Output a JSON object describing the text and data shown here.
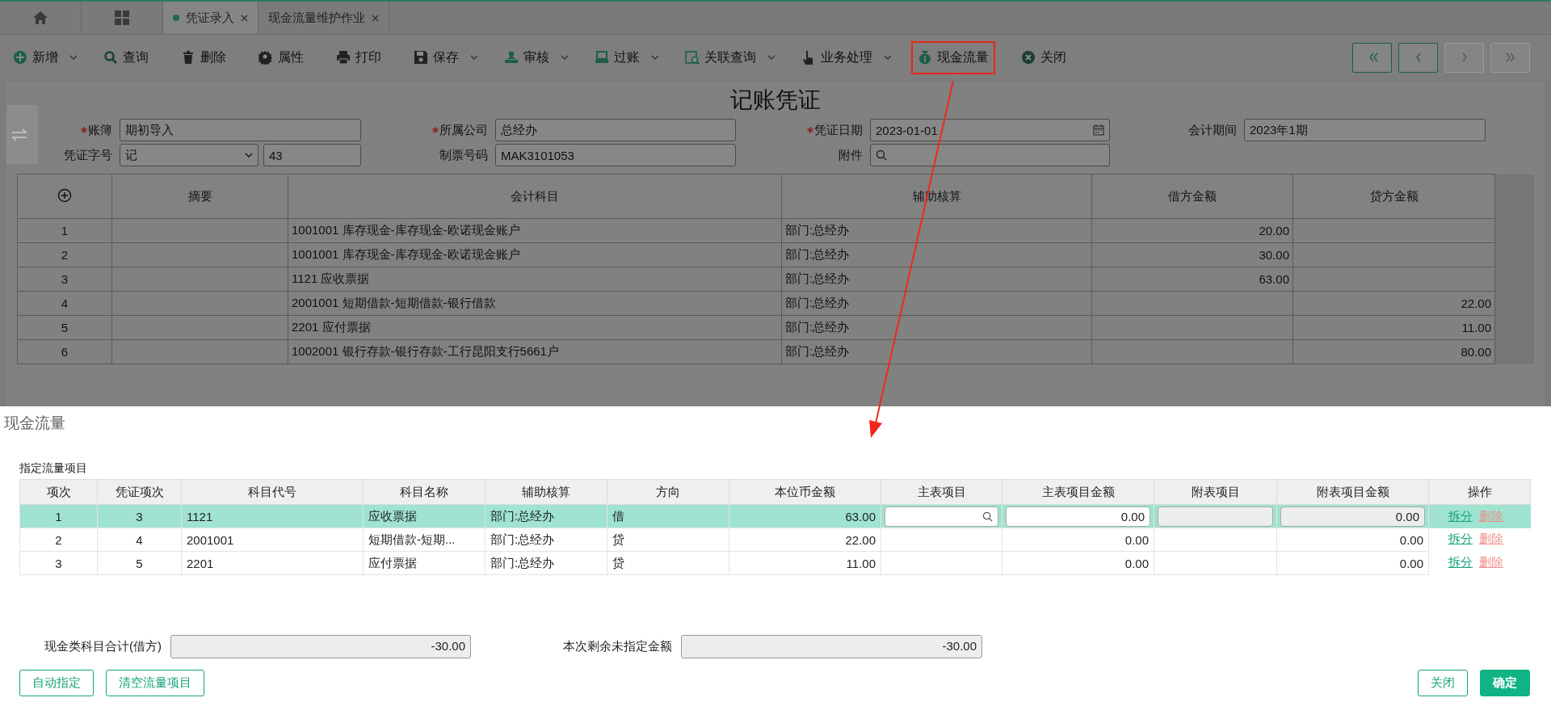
{
  "tabs": [
    {
      "label": "凭证录入",
      "selected": true,
      "closable": true
    },
    {
      "label": "现金流量维护作业",
      "selected": false,
      "closable": true
    }
  ],
  "toolbar": [
    {
      "label": "新增",
      "menu": true,
      "highlighted": false
    },
    {
      "label": "查询",
      "menu": false,
      "highlighted": false
    },
    {
      "label": "删除",
      "menu": false,
      "highlighted": false
    },
    {
      "label": "属性",
      "menu": false,
      "highlighted": false
    },
    {
      "label": "打印",
      "menu": false,
      "highlighted": false
    },
    {
      "label": "保存",
      "menu": true,
      "highlighted": false
    },
    {
      "label": "审核",
      "menu": true,
      "highlighted": false
    },
    {
      "label": "过账",
      "menu": true,
      "highlighted": false
    },
    {
      "label": "关联查询",
      "menu": true,
      "highlighted": false
    },
    {
      "label": "业务处理",
      "menu": true,
      "highlighted": false
    },
    {
      "label": "现金流量",
      "menu": false,
      "highlighted": true
    },
    {
      "label": "关闭",
      "menu": false,
      "highlighted": false
    }
  ],
  "nav_buttons": [
    {
      "kind": "first",
      "disabled": false
    },
    {
      "kind": "previous",
      "disabled": false
    },
    {
      "kind": "next",
      "disabled": true
    },
    {
      "kind": "last",
      "disabled": true
    }
  ],
  "voucher": {
    "title": "记账凭证",
    "fields": [
      {
        "label": "账簿",
        "required": true,
        "kind": "text",
        "value": "期初导入"
      },
      {
        "label": "所属公司",
        "required": true,
        "kind": "text",
        "value": "总经办"
      },
      {
        "label": "凭证日期",
        "required": true,
        "kind": "date",
        "value": "2023-01-01"
      },
      {
        "label": "会计期间",
        "required": false,
        "kind": "text",
        "value": "2023年1期"
      },
      {
        "label": "凭证字号",
        "required": false,
        "kind": "select_number",
        "value": "记",
        "number": "43"
      },
      {
        "label": "制票号码",
        "required": false,
        "kind": "text",
        "value": "MAK3101053"
      },
      {
        "label": "附件",
        "required": false,
        "kind": "lookup"
      }
    ],
    "columns": [
      "摘要",
      "会计科目",
      "辅助核算",
      "借方金额",
      "贷方金额"
    ],
    "rows": [
      {
        "no": "1",
        "account": "1001001 库存现金-库存现金-欧诺现金账户",
        "aux": "部门:总经办",
        "debit": "20.00"
      },
      {
        "no": "2",
        "account": "1001001 库存现金-库存现金-欧诺现金账户",
        "aux": "部门:总经办",
        "debit": "30.00"
      },
      {
        "no": "3",
        "account": "1121 应收票据",
        "aux": "部门:总经办",
        "debit": "63.00"
      },
      {
        "no": "4",
        "account": "2001001 短期借款-短期借款-银行借款",
        "aux": "部门:总经办",
        "credit": "22.00"
      },
      {
        "no": "5",
        "account": "2201 应付票据",
        "aux": "部门:总经办",
        "credit": "11.00"
      },
      {
        "no": "6",
        "account": "1002001 银行存款-银行存款-工行昆阳支行5661户",
        "aux": "部门:总经办",
        "credit": "80.00"
      }
    ]
  },
  "cash_flow": {
    "title": "现金流量",
    "section": "指定流量项目",
    "columns": [
      "项次",
      "凭证项次",
      "科目代号",
      "科目名称",
      "辅助核算",
      "方向",
      "本位币金额",
      "主表项目",
      "主表项目金额",
      "附表项目",
      "附表项目金额",
      "操作"
    ],
    "rows": [
      {
        "selected": true,
        "no": "1",
        "entry_no": "3",
        "code": "1121",
        "name": "应收票据",
        "aux": "部门:总经办",
        "direction": "借",
        "amount": "63.00",
        "main_amount": "0.00",
        "sub_amount": "0.00",
        "actions": [
          "拆分",
          "删除"
        ]
      },
      {
        "selected": false,
        "no": "2",
        "entry_no": "4",
        "code": "2001001",
        "name": "短期借款-短期...",
        "aux": "部门:总经办",
        "direction": "贷",
        "amount": "22.00",
        "main_amount": "0.00",
        "sub_amount": "0.00",
        "actions": [
          "拆分",
          "删除"
        ]
      },
      {
        "selected": false,
        "no": "3",
        "entry_no": "5",
        "code": "2201",
        "name": "应付票据",
        "aux": "部门:总经办",
        "direction": "贷",
        "amount": "11.00",
        "main_amount": "0.00",
        "sub_amount": "0.00",
        "actions": [
          "拆分",
          "删除"
        ]
      }
    ],
    "totals": [
      {
        "label": "现金类科目合计(借方)",
        "value": "-30.00"
      },
      {
        "label": "本次剩余未指定金额",
        "value": "-30.00"
      }
    ],
    "left_buttons": [
      {
        "label": "自动指定",
        "kind": "outline"
      },
      {
        "label": "清空流量项目",
        "kind": "outline"
      }
    ],
    "right_buttons": [
      {
        "label": "关闭",
        "kind": "outline"
      },
      {
        "label": "确定",
        "kind": "primary"
      }
    ]
  }
}
